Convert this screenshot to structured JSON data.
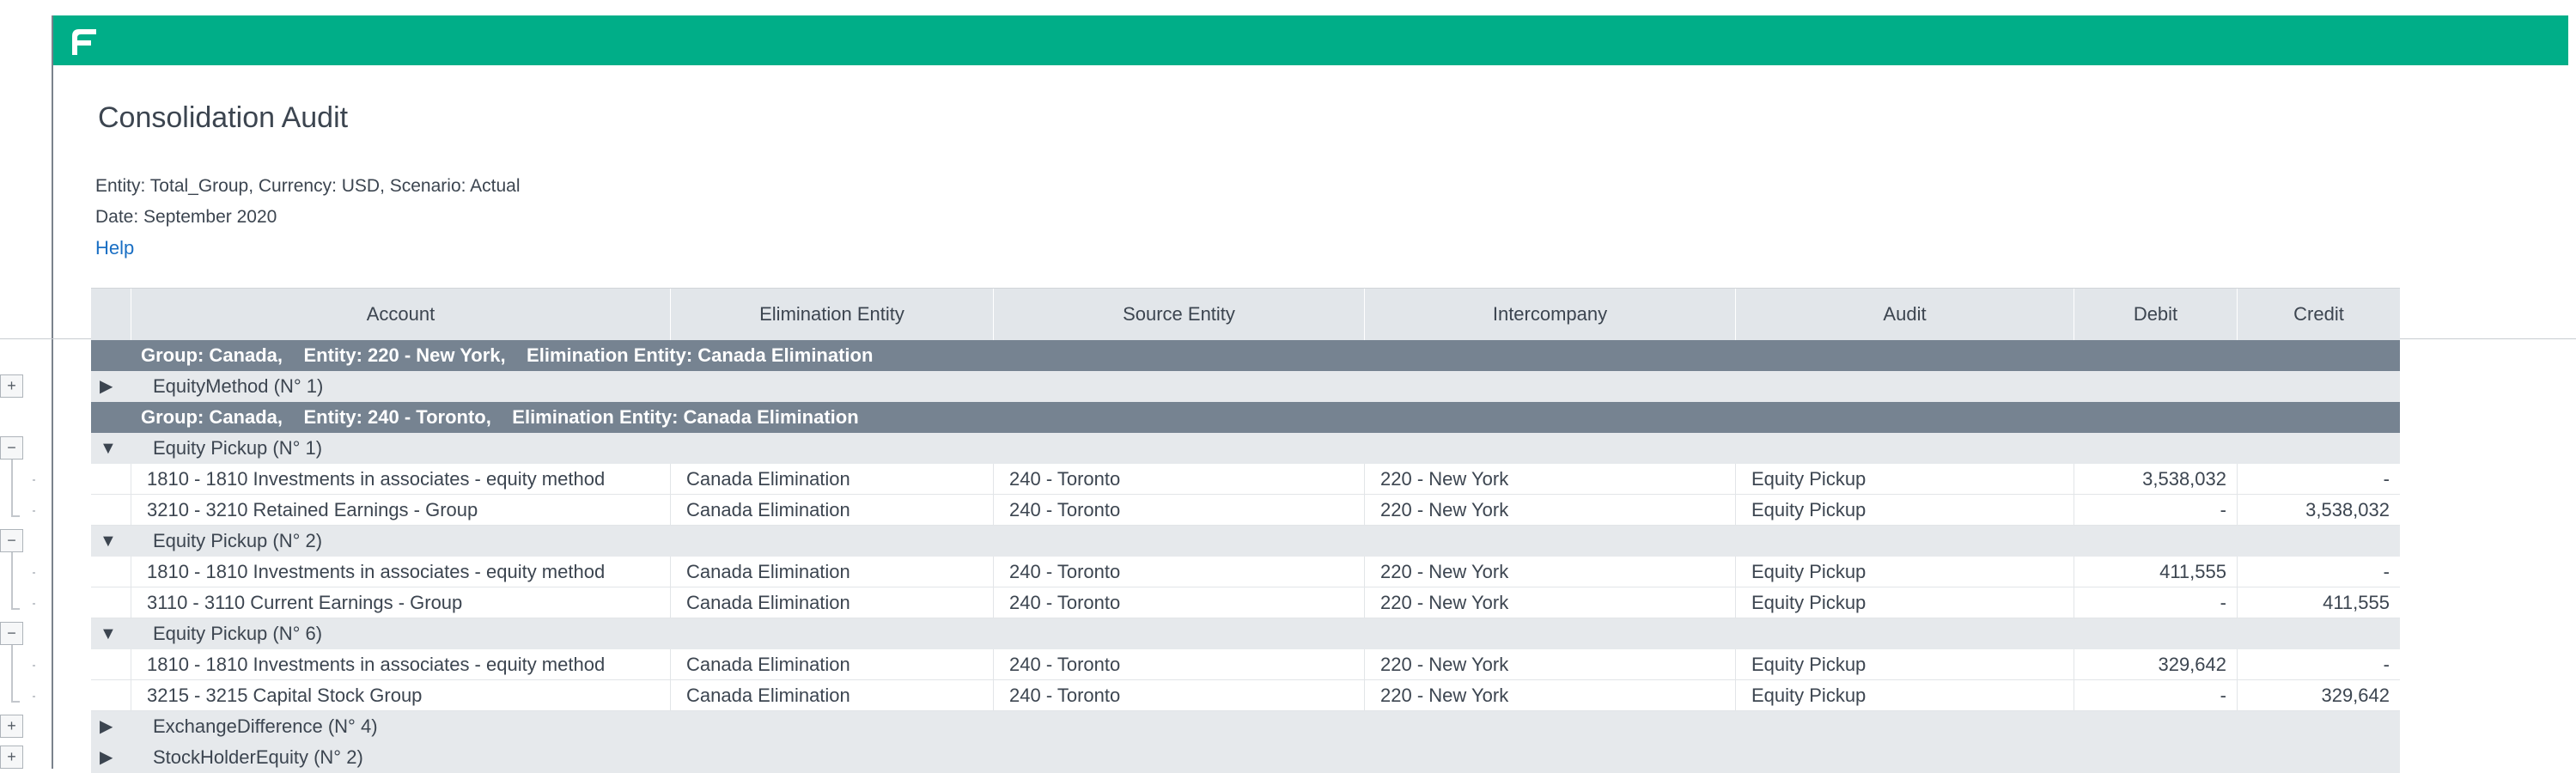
{
  "app": {
    "brand_color": "#00ae88",
    "logo_icon": "brand-logo-icon"
  },
  "report": {
    "title": "Consolidation Audit",
    "info_line_1": "Entity: Total_Group, Currency: USD, Scenario: Actual",
    "info_line_2": "Date: September 2020",
    "help_label": "Help"
  },
  "table": {
    "headers": [
      "Account",
      "Elimination Entity",
      "Source Entity",
      "Intercompany",
      "Audit",
      "Debit",
      "Credit"
    ],
    "group_1": {
      "label": "Group: Canada,    Entity: 220 - New York,    Elimination Entity: Canada Elimination",
      "section_1": {
        "label": "EquityMethod (N° 1)",
        "toggle": "+"
      }
    },
    "group_2": {
      "label": "Group: Canada,    Entity: 240 - Toronto,    Elimination Entity: Canada Elimination",
      "section_1": {
        "label": "Equity Pickup (N° 1)",
        "toggle": "−",
        "rows": [
          {
            "account": "1810 -  1810 Investments in associates - equity method",
            "elim": "Canada Elimination",
            "source": "240 - Toronto",
            "ic": "220 - New York",
            "audit": "Equity Pickup",
            "debit": "3,538,032",
            "credit": "-"
          },
          {
            "account": "3210 -  3210 Retained Earnings - Group",
            "elim": "Canada Elimination",
            "source": "240 - Toronto",
            "ic": "220 - New York",
            "audit": "Equity Pickup",
            "debit": "-",
            "credit": "3,538,032"
          }
        ]
      },
      "section_2": {
        "label": "Equity Pickup (N° 2)",
        "toggle": "−",
        "rows": [
          {
            "account": "1810 -  1810 Investments in associates - equity method",
            "elim": "Canada Elimination",
            "source": "240 - Toronto",
            "ic": "220 - New York",
            "audit": "Equity Pickup",
            "debit": "411,555",
            "credit": "-"
          },
          {
            "account": "3110 -  3110 Current Earnings - Group",
            "elim": "Canada Elimination",
            "source": "240 - Toronto",
            "ic": "220 - New York",
            "audit": "Equity Pickup",
            "debit": "-",
            "credit": "411,555"
          }
        ]
      },
      "section_3": {
        "label": "Equity Pickup (N° 6)",
        "toggle": "−",
        "rows": [
          {
            "account": "1810 -  1810 Investments in associates - equity method",
            "elim": "Canada Elimination",
            "source": "240 - Toronto",
            "ic": "220 - New York",
            "audit": "Equity Pickup",
            "debit": "329,642",
            "credit": "-"
          },
          {
            "account": "3215 -  3215 Capital Stock Group",
            "elim": "Canada Elimination",
            "source": "240 - Toronto",
            "ic": "220 - New York",
            "audit": "Equity Pickup",
            "debit": "-",
            "credit": "329,642"
          }
        ]
      },
      "section_4": {
        "label": "ExchangeDifference (N° 4)",
        "toggle": "+"
      },
      "section_5": {
        "label": "StockHolderEquity (N° 2)",
        "toggle": "+"
      }
    }
  }
}
